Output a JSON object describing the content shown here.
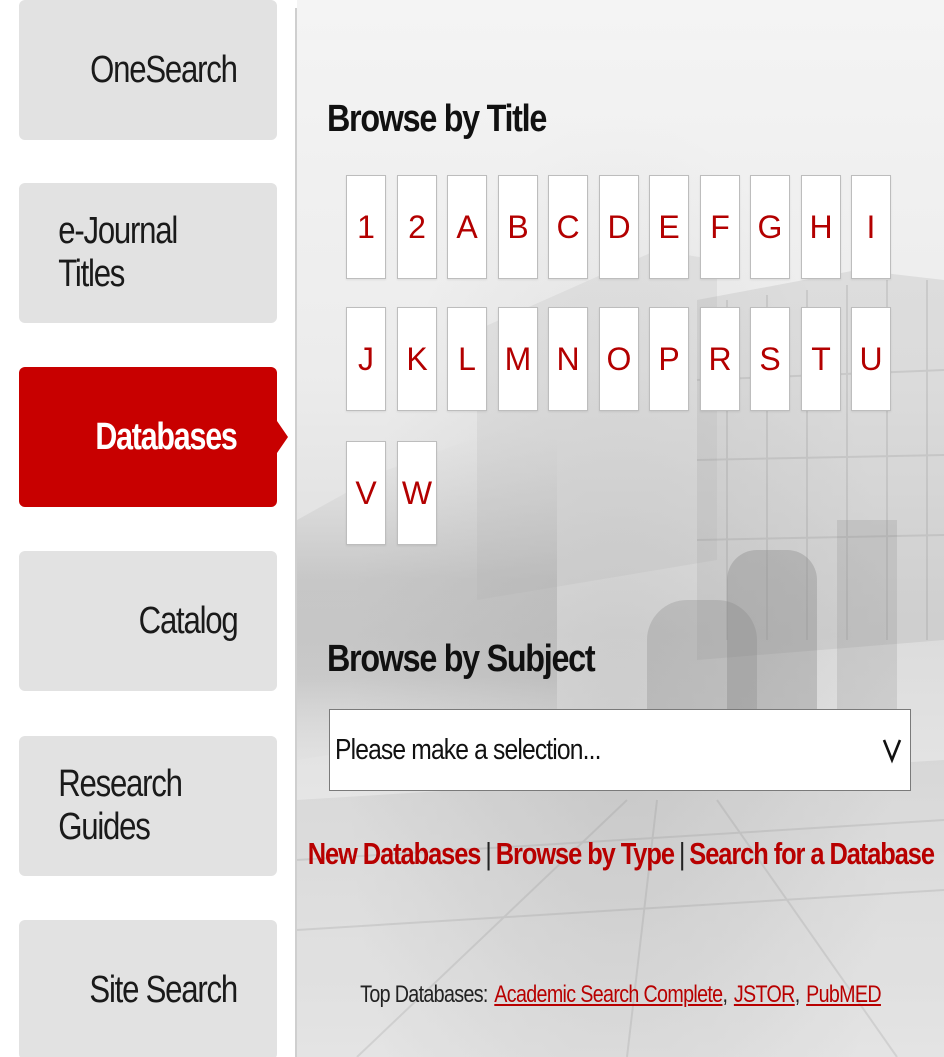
{
  "sidebar": {
    "items": [
      {
        "label": "OneSearch",
        "active": false
      },
      {
        "label": "e-Journal Titles",
        "active": false
      },
      {
        "label": "Databases",
        "active": true
      },
      {
        "label": "Catalog",
        "active": false
      },
      {
        "label": "Research Guides",
        "active": false
      },
      {
        "label": "Site Search",
        "active": false
      }
    ]
  },
  "browse_title": {
    "heading": "Browse by Title",
    "letters": [
      "1",
      "2",
      "A",
      "B",
      "C",
      "D",
      "E",
      "F",
      "G",
      "H",
      "I",
      "J",
      "K",
      "L",
      "M",
      "N",
      "O",
      "P",
      "R",
      "S",
      "T",
      "U",
      "V",
      "W"
    ]
  },
  "browse_subject": {
    "heading": "Browse by Subject",
    "select_value": "Please make a selection..."
  },
  "links": {
    "new_databases": "New Databases",
    "browse_by_type": "Browse by Type",
    "search_database": "Search for a Database",
    "separator": "|"
  },
  "top_databases": {
    "label": "Top Databases:",
    "items": [
      "Academic Search Complete",
      "JSTOR",
      "PubMED"
    ]
  },
  "colors": {
    "accent": "#c80000",
    "link": "#b80000",
    "tab_bg": "#e2e2e2"
  }
}
